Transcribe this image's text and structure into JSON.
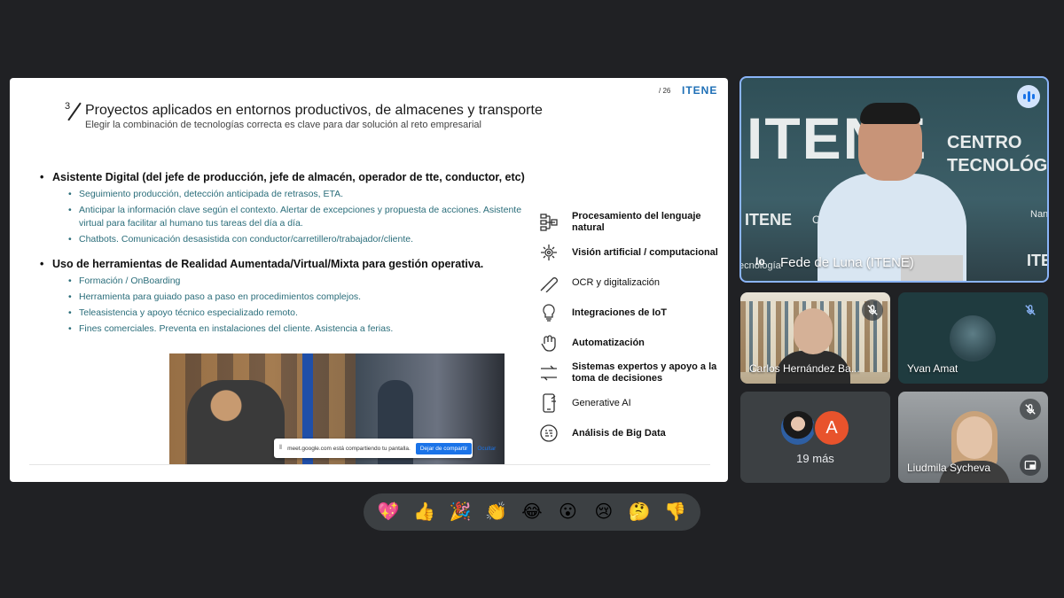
{
  "slide": {
    "number": "3",
    "title": "Proyectos aplicados en entornos productivos, de almacenes y transporte",
    "subtitle": "Elegir la combinación de tecnologías correcta es clave para dar solución al reto empresarial",
    "page_indicator": "/ 26",
    "logo": "ITENE",
    "bullets": [
      {
        "title": "Asistente Digital (del jefe de producción, jefe de almacén, operador de tte, conductor, etc)",
        "items": [
          "Seguimiento producción, detección anticipada de retrasos, ETA.",
          "Anticipar la información clave según el contexto. Alertar de excepciones y propuesta de acciones. Asistente virtual para facilitar al humano tus tareas del día a día.",
          "Chatbots. Comunicación desasistida con conductor/carretillero/trabajador/cliente."
        ]
      },
      {
        "title": "Uso de herramientas de Realidad Aumentada/Virtual/Mixta para gestión operativa.",
        "items": [
          "Formación / OnBoarding",
          "Herramienta para guiado paso a paso en procedimientos complejos.",
          "Teleasistencia y apoyo técnico especializado remoto.",
          "Fines comerciales. Preventa en instalaciones del cliente. Asistencia a ferias."
        ]
      }
    ],
    "technologies": [
      {
        "label": "Procesamiento del lenguaje natural",
        "bold": true,
        "icon": "language-processing-icon"
      },
      {
        "label": "Visión artificial / computacional",
        "bold": true,
        "icon": "computer-vision-icon"
      },
      {
        "label": "OCR y digitalización",
        "bold": false,
        "icon": "ocr-icon"
      },
      {
        "label": "Integraciones de IoT",
        "bold": true,
        "icon": "iot-icon"
      },
      {
        "label": "Automatización",
        "bold": true,
        "icon": "automation-icon"
      },
      {
        "label": "Sistemas expertos y apoyo a la toma de decisiones",
        "bold": true,
        "icon": "expert-systems-icon"
      },
      {
        "label": "Generative AI",
        "bold": false,
        "icon": "generative-ai-icon"
      },
      {
        "label": "Análisis de Big Data",
        "bold": true,
        "icon": "big-data-icon"
      }
    ],
    "share_bar": {
      "text": "meet.google.com está compartiendo tu pantalla.",
      "stop_label": "Dejar de compartir",
      "hide_label": "Ocultar"
    }
  },
  "speaker": {
    "name": "Fede de Luna (ITENE)",
    "logo_text": "Io",
    "bg_itene": "ITENE",
    "bg_centro_line1": "CENTRO",
    "bg_centro_line2": "TECNOLÓGI",
    "bg_small1": "ITENE",
    "bg_small2": "Co",
    "bg_small3": "Nano",
    "bg_small4": "ITE",
    "bg_tecnologia": "tecnología"
  },
  "participants": [
    {
      "name": "Carlos Hernández Ba...",
      "muted": true
    },
    {
      "name": "Yvan Amat",
      "muted": true
    },
    {
      "name": "Liudmila Sycheva",
      "muted": true
    }
  ],
  "more": {
    "label": "19 más",
    "avatar_letter": "A"
  },
  "reactions": [
    {
      "emoji": "💖",
      "name": "heart-reaction"
    },
    {
      "emoji": "👍",
      "name": "thumbs-up-reaction"
    },
    {
      "emoji": "🎉",
      "name": "party-reaction"
    },
    {
      "emoji": "👏",
      "name": "clap-reaction"
    },
    {
      "emoji": "😂",
      "name": "laugh-reaction"
    },
    {
      "emoji": "😮",
      "name": "surprised-reaction"
    },
    {
      "emoji": "😢",
      "name": "sad-reaction"
    },
    {
      "emoji": "🤔",
      "name": "thinking-reaction"
    },
    {
      "emoji": "👎",
      "name": "thumbs-down-reaction"
    }
  ],
  "colors": {
    "accent": "#1a73e8",
    "slide_sub_text": "#2a6d7a",
    "tile_bg": "#3c4043",
    "avatar_orange": "#e8532c"
  }
}
